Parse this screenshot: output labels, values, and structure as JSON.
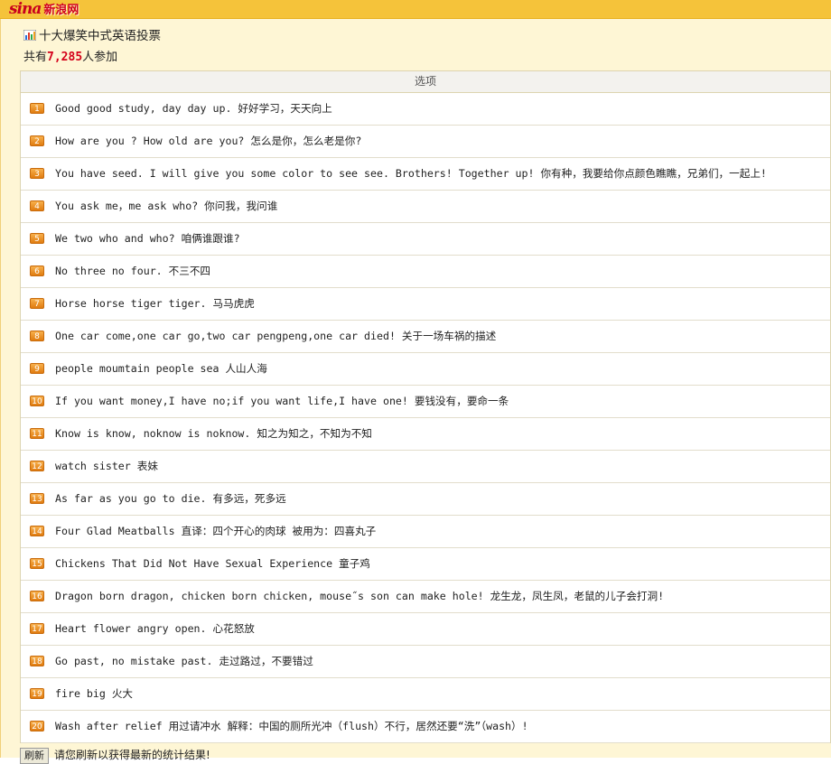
{
  "header": {
    "logo_text": "sina",
    "logo_cn": "新浪网"
  },
  "poll": {
    "title": "十大爆笑中式英语投票",
    "count_prefix": "共有",
    "count_value": "7,285",
    "count_suffix": "人参加",
    "column_header": "选项",
    "options": [
      {
        "num": "1",
        "text": "Good good study, day day up. 好好学习，天天向上"
      },
      {
        "num": "2",
        "text": "How are you ? How old are you? 怎么是你，怎么老是你?"
      },
      {
        "num": "3",
        "text": "You have seed. I will give you some color to see see. Brothers! Together up! 你有种，我要给你点颜色瞧瞧，兄弟们，一起上!"
      },
      {
        "num": "4",
        "text": "You ask me，me ask who?  你问我，我问谁"
      },
      {
        "num": "5",
        "text": "We two who and who? 咱俩谁跟谁?"
      },
      {
        "num": "6",
        "text": "No three no four. 不三不四"
      },
      {
        "num": "7",
        "text": "Horse horse tiger tiger. 马马虎虎"
      },
      {
        "num": "8",
        "text": "One car come,one car go,two car pengpeng,one car died! 关于一场车祸的描述"
      },
      {
        "num": "9",
        "text": "people moumtain people sea 人山人海"
      },
      {
        "num": "10",
        "text": "If you want money,I have no;if you want life,I have one! 要钱没有，要命一条"
      },
      {
        "num": "11",
        "text": "Know is know, noknow is noknow. 知之为知之，不知为不知"
      },
      {
        "num": "12",
        "text": "watch sister 表妹"
      },
      {
        "num": "13",
        "text": "As far as you go to die. 有多远，死多远"
      },
      {
        "num": "14",
        "text": "Four Glad Meatballs 直译：四个开心的肉球 被用为：四喜丸子"
      },
      {
        "num": "15",
        "text": "Chickens That Did Not Have Sexual Experience 童子鸡"
      },
      {
        "num": "16",
        "text": "Dragon born dragon, chicken born chicken, mouse˝s son can make hole! 龙生龙，凤生凤，老鼠的儿子会打洞!"
      },
      {
        "num": "17",
        "text": "Heart flower angry open. 心花怒放"
      },
      {
        "num": "18",
        "text": "Go past, no mistake past. 走过路过，不要错过"
      },
      {
        "num": "19",
        "text": "fire big 火大"
      },
      {
        "num": "20",
        "text": "Wash after relief 用过请冲水 解释：中国的厕所光冲（flush）不行，居然还要“洗”（wash）!"
      }
    ]
  },
  "footer": {
    "refresh_label": "刷新",
    "refresh_note": "请您刷新以获得最新的统计结果!"
  },
  "colors": {
    "topbar": "#f5c33a",
    "panel_bg": "#fef6d5",
    "badge": "#e8901f",
    "count_number": "#d4001a"
  }
}
